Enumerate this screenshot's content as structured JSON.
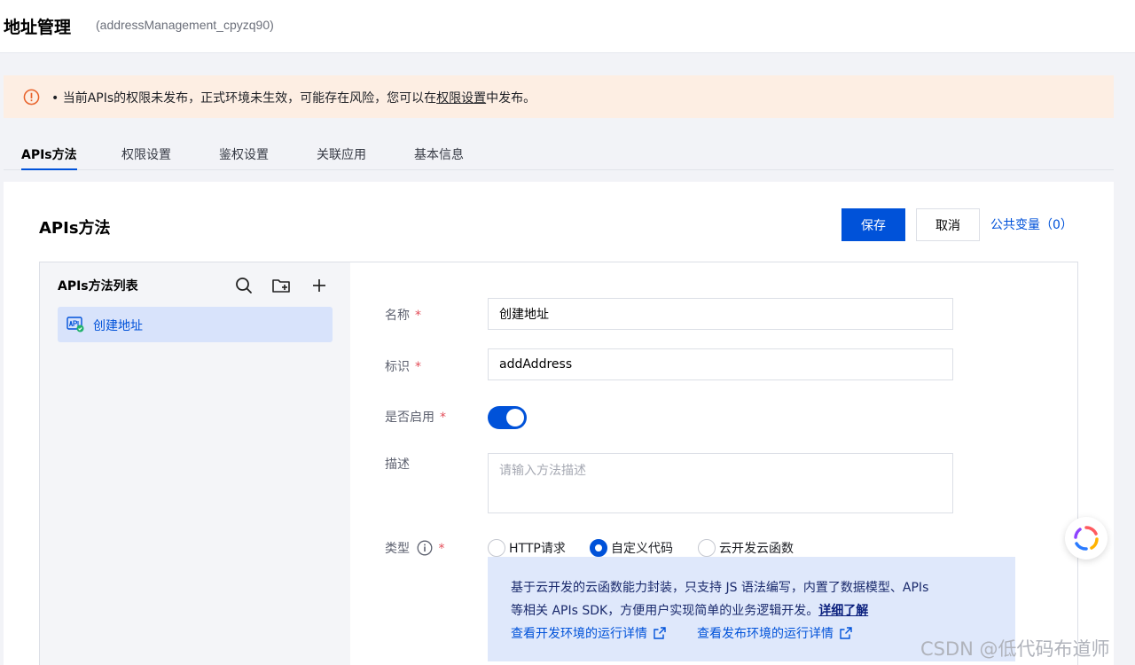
{
  "header": {
    "title": "地址管理",
    "subtitle": "(addressManagement_cpyzq90)"
  },
  "alert": {
    "prefix": "• 当前APIs的权限未发布，正式环境未生效，可能存在风险，您可以在",
    "link": "权限设置",
    "suffix": "中发布。"
  },
  "tabs": [
    {
      "label": "APIs方法",
      "active": true
    },
    {
      "label": "权限设置"
    },
    {
      "label": "鉴权设置"
    },
    {
      "label": "关联应用"
    },
    {
      "label": "基本信息"
    }
  ],
  "content": {
    "title": "APIs方法",
    "save_label": "保存",
    "cancel_label": "取消",
    "public_vars_label": "公共变量（0）"
  },
  "method_list": {
    "title": "APIs方法列表",
    "items": [
      {
        "label": "创建地址",
        "selected": true
      }
    ]
  },
  "form": {
    "name_label": "名称",
    "name_value": "创建地址",
    "id_label": "标识",
    "id_value": "addAddress",
    "enabled_label": "是否启用",
    "enabled": true,
    "desc_label": "描述",
    "desc_placeholder": "请输入方法描述",
    "type_label": "类型",
    "type_options": [
      {
        "label": "HTTP请求",
        "selected": false
      },
      {
        "label": "自定义代码",
        "selected": true
      },
      {
        "label": "云开发云函数",
        "selected": false
      }
    ],
    "info": {
      "line1": "基于云开发的云函数能力封装，只支持 JS 语法编写，内置了数据模型、APIs",
      "line2": "等相关 APIs SDK，方便用户实现简单的业务逻辑开发。",
      "more_link": "详细了解",
      "dev_link": "查看开发环境的运行详情",
      "prod_link": "查看发布环境的运行详情"
    }
  },
  "watermark": "CSDN @低代码布道师",
  "colors": {
    "primary": "#0052d9",
    "alert_bg": "#fdeee3",
    "warn": "#e8622a",
    "required": "#e34d59"
  }
}
